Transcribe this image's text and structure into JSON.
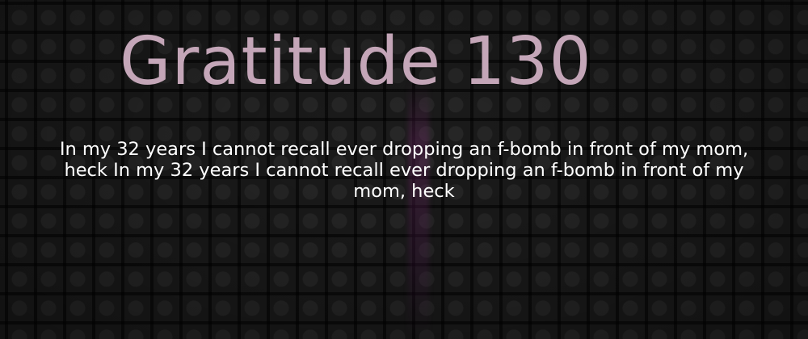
{
  "card": {
    "title": "Gratitude 130",
    "body": "In my 32 years I cannot recall ever dropping an f-bomb in front of my mom, heck In my 32 years I cannot recall ever dropping an f-bomb in front of my mom, heck"
  },
  "colors": {
    "background": "#1b1b1b",
    "title": "#c4a6b8",
    "body": "#ffffff",
    "accent_glow": "#782870"
  }
}
